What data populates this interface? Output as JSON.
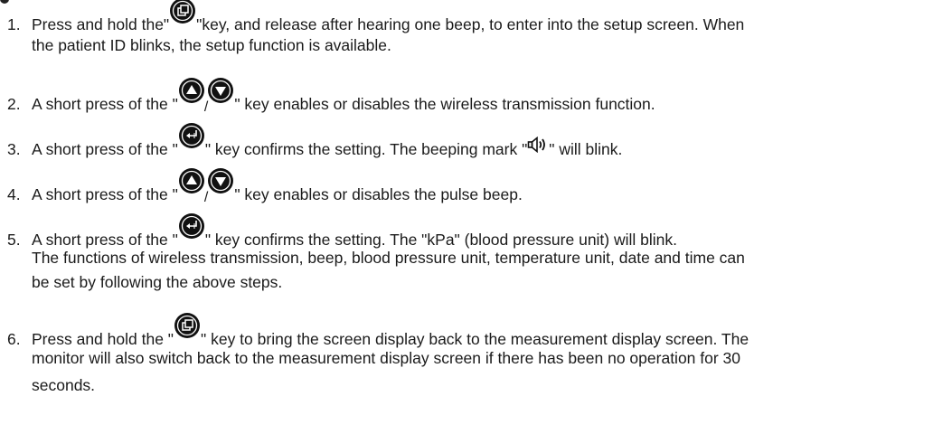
{
  "icons": {
    "setup_key": "setup-key-icon",
    "up_key": "up-arrow-key-icon",
    "down_key": "down-arrow-key-icon",
    "confirm_key": "confirm-enter-key-icon",
    "beep_mark": "speaker-beep-icon"
  },
  "steps": [
    {
      "number": "1.",
      "before": "Press and hold the\"",
      "after": "\"key, and release after hearing one beep, to enter into the setup screen. When",
      "cont": "the patient ID blinks, the setup function is available."
    },
    {
      "number": "2.",
      "before": "A short press of the \"",
      "sep": "/",
      "after": "\" key enables or disables the wireless transmission function."
    },
    {
      "number": "3.",
      "before": "A short press of the \"",
      "after": "\" key confirms the setting. The beeping mark \"",
      "after2": "\" will blink."
    },
    {
      "number": "4.",
      "before": "A short press of the \"",
      "sep": "/",
      "after": "\" key enables or disables the pulse beep."
    },
    {
      "number": "5.",
      "before": "A short press of the \"",
      "after": "\" key confirms the setting. The \"kPa\" (blood pressure unit) will blink.",
      "cont1": "The functions of wireless transmission, beep, blood pressure unit, temperature unit, date and time can",
      "cont2": "be set by following the above steps."
    },
    {
      "number": "6.",
      "before": "Press and hold the \"",
      "after": "\" key to bring the screen display back to the measurement display screen. The",
      "cont1": "monitor will also switch back to the measurement display screen if there has been no operation for 30",
      "cont2": "seconds."
    }
  ]
}
